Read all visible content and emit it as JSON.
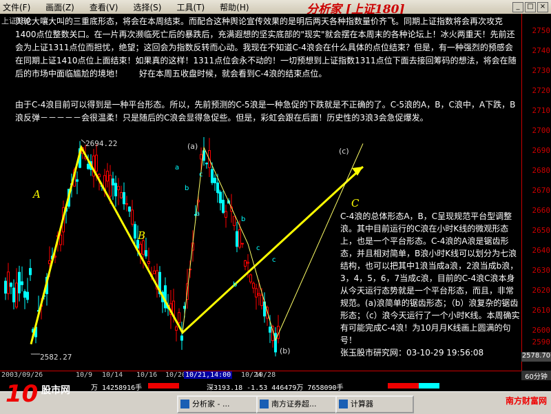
{
  "menu": {
    "items": [
      "文件(F)",
      "画面(Z)",
      "查看(V)",
      "选择(S)",
      "工具(T)",
      "帮助(H)"
    ]
  },
  "app_title": "分析家 [上证180]",
  "window_buttons": [
    "_",
    "□",
    "×"
  ],
  "index_label": "上证180",
  "price_ticks": [
    "2750",
    "2740",
    "2730",
    "2720",
    "2710",
    "2700",
    "2690",
    "2680",
    "2670",
    "2660",
    "2650",
    "2640",
    "2630",
    "2620",
    "2610",
    "2600",
    "2590"
  ],
  "current_price": "2578.70",
  "period": "60分钟",
  "notes": {
    "para1": "舆论大嚷大叫的三重底形态，将会在本周结束。而配合这种舆论宣传效果的是明后两天各种指数量价齐飞。同期上证指数将会再次攻克1400点位整数关口。在一片再次濒临死亡后的暴跌后，充满遐想的坚实底部的\"现实\"就会摆在本周末的各种论坛上！冰火两重天！先前还会为上证1311点位而担忧，绝望；这回会为指数反转而心动。我现在不知道C-4浪会在什么具体的点位结束？但是，有一种强烈的预感会在同期上证1410点位上面结束！如果真的这样！1311点位会永不动的！一切预想到上证指数1311点位下面去接回筹码的想法，将会在随后的市场中面临尴尬的境地！　　好在本周五收盘时候，就会看到C-4浪的结束点位。",
    "para2": "由于C-4浪目前可以得到是一种平台形态。所以，先前预测的C-5浪是一种急促的下跌就是不正确的了。C-5浪的A，B，C浪中，A下跌，B浪反弹－－－－－会很温柔！只是随后的C浪会显得急促些。但是，彩虹会跟在后面！历史性的3浪3会急促爆发。",
    "para3": "C-4浪的总体形态A，B，C呈现规范平台型调整浪。其中目前运行的C浪在小时K线的微观形态上，也是一个平台形态。C-4浪的A浪是锯齿形态，并且相对简单，B浪小时K线可以划分为七浪结构，也可以把其中1浪当成a浪，2浪当成b浪，3，4，5，6，7当成c浪，目前的C-4浪C浪本身从今天运行态势就是一个平台形态，而且，非常规范。(a)浪简单的锯齿形态；（b）浪复杂的锯齿形态；（c）浪今天运行了一个小时K线。本周确实有可能完成C-4浪！为10月月K线画上圆满的句号！",
    "signature": "张玉股市研究网：03-10-29 19:56:08"
  },
  "labels": {
    "high": "2694.22",
    "low": "2582.27"
  },
  "waves_big": [
    "A",
    "B",
    "C"
  ],
  "waves_small": [
    "(a)",
    "(b)",
    "(c)",
    "a",
    "b",
    "c",
    "a",
    "b",
    "c",
    "a",
    "b",
    "c"
  ],
  "dates": [
    "2003/09/26",
    "10/9",
    "10/14",
    "10/16",
    "10/20",
    "10/21,14:00",
    "10/24",
    "10/28"
  ],
  "status": {
    "seg1": "万 14258916手",
    "seg2": "深3193.18 -1.53 446479万 7658090手"
  },
  "taskbar": {
    "items": [
      "分析家 - ...",
      "南方证券超...",
      "计算器"
    ]
  },
  "watermarks": [
    "10",
    "股市网",
    "南方财富网"
  ],
  "colors": {
    "up": "#ff0000",
    "down": "#00ffff",
    "wave_line": "#ffff00",
    "axis": "#cc0000"
  }
}
